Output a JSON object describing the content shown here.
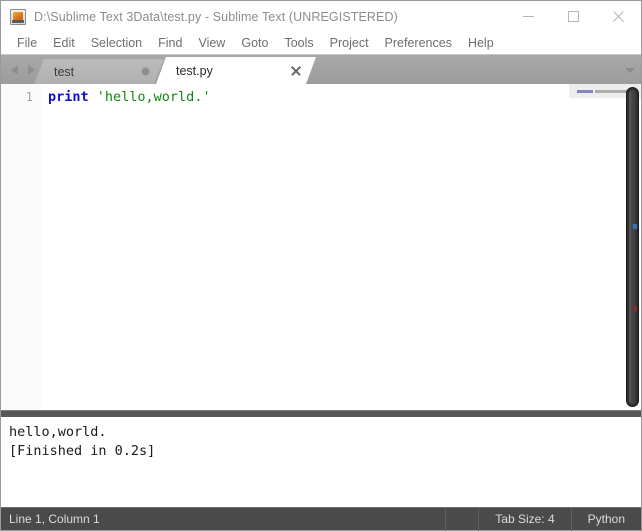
{
  "window": {
    "title": "D:\\Sublime Text 3Data\\test.py - Sublime Text (UNREGISTERED)",
    "app_icon": "sublime-text-icon",
    "controls": {
      "minimize": "minimize-icon",
      "maximize": "maximize-icon",
      "close": "close-icon"
    }
  },
  "menubar": {
    "items": [
      {
        "label": "File"
      },
      {
        "label": "Edit"
      },
      {
        "label": "Selection"
      },
      {
        "label": "Find"
      },
      {
        "label": "View"
      },
      {
        "label": "Goto"
      },
      {
        "label": "Tools"
      },
      {
        "label": "Project"
      },
      {
        "label": "Preferences"
      },
      {
        "label": "Help"
      }
    ]
  },
  "tabbar": {
    "nav_prev": "chevron-left-icon",
    "nav_next": "chevron-right-icon",
    "overflow": "chevron-down-icon",
    "tabs": [
      {
        "label": "test",
        "active": false,
        "dirty": true
      },
      {
        "label": "test.py",
        "active": true,
        "dirty": false
      }
    ]
  },
  "editor": {
    "line_numbers": [
      "1"
    ],
    "code": {
      "keyword": "print",
      "space": " ",
      "string": "'hello,world.'"
    },
    "colors": {
      "keyword": "#1010c8",
      "string": "#118811",
      "gutter_text": "#a0a0a0"
    },
    "scrollbar": "vertical-scrollbar"
  },
  "output": {
    "lines": [
      "hello,world.",
      "[Finished in 0.2s]"
    ]
  },
  "statusbar": {
    "position": "Line 1, Column 1",
    "tab_size": "Tab Size: 4",
    "syntax": "Python"
  }
}
